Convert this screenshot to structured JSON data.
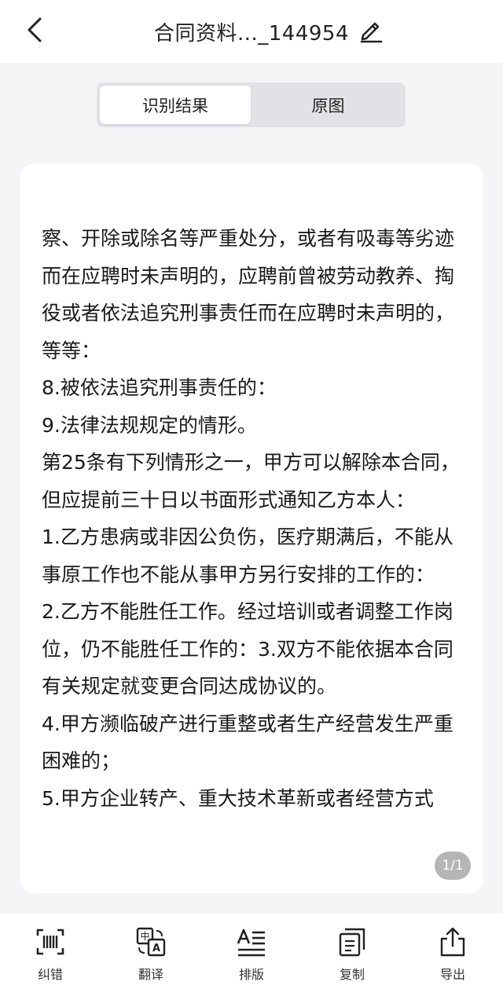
{
  "header": {
    "title": "合同资料..._144954"
  },
  "tabs": [
    {
      "label": "识别结果",
      "active": true
    },
    {
      "label": "原图",
      "active": false
    }
  ],
  "content": {
    "paragraphs": [
      "察、开除或除名等严重处分，或者有吸毒等劣迹而在应聘时未声明的，应聘前曾被劳动教养、掏役或者依法追究刑事责任而在应聘时未声明的，等等：",
      "8.被依法追究刑事责任的：",
      "9.法律法规规定的情形。",
      "第25条有下列情形之一，甲方可以解除本合同，但应提前三十日以书面形式通知乙方本人：",
      "1.乙方患病或非因公负伤，医疗期满后，不能从事原工作也不能从事甲方另行安排的工作的：",
      "2.乙方不能胜任工作。经过培训或者调整工作岗位，仍不能胜任工作的：3.双方不能依据本合同有关规定就变更合同达成协议的。",
      "4.甲方濒临破产进行重整或者生产经营发生严重困难的；",
      "5.甲方企业转产、重大技术革新或者经营方式"
    ],
    "page_indicator": "1/1"
  },
  "toolbar": {
    "items": [
      {
        "label": "纠错",
        "icon": "scan-barcode-icon"
      },
      {
        "label": "翻译",
        "icon": "translate-icon"
      },
      {
        "label": "排版",
        "icon": "layout-text-icon"
      },
      {
        "label": "复制",
        "icon": "copy-icon"
      },
      {
        "label": "导出",
        "icon": "export-icon"
      }
    ]
  }
}
